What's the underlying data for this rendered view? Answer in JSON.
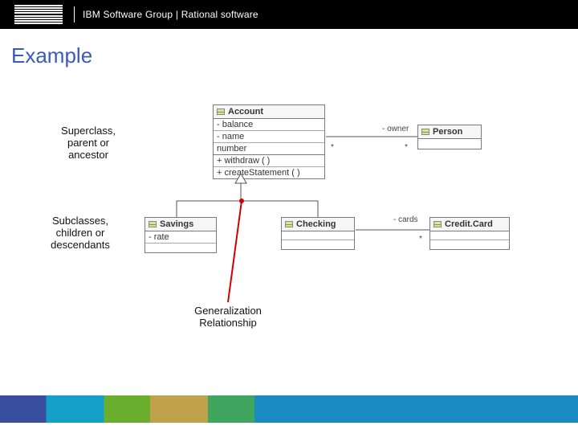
{
  "header": {
    "title": "IBM Software Group | Rational software"
  },
  "slide": {
    "title": "Example"
  },
  "annotations": {
    "superclass": "Superclass,\nparent or\nancestor",
    "subclasses": "Subclasses,\nchildren or\ndescendants",
    "generalization": "Generalization\nRelationship"
  },
  "classes": {
    "account": {
      "name": "Account",
      "attributes": [
        "- balance",
        "- name",
        "  number"
      ],
      "operations": [
        "+ withdraw ( )",
        "+ createStatement ( )"
      ]
    },
    "person": {
      "name": "Person"
    },
    "savings": {
      "name": "Savings",
      "attributes": [
        "- rate"
      ]
    },
    "checking": {
      "name": "Checking"
    },
    "creditcard": {
      "name": "Credit.Card"
    }
  },
  "associations": {
    "owner_label": "- owner",
    "mult_account_side": "*",
    "mult_person_side": "*",
    "cards_label": "- cards",
    "star": "*"
  }
}
